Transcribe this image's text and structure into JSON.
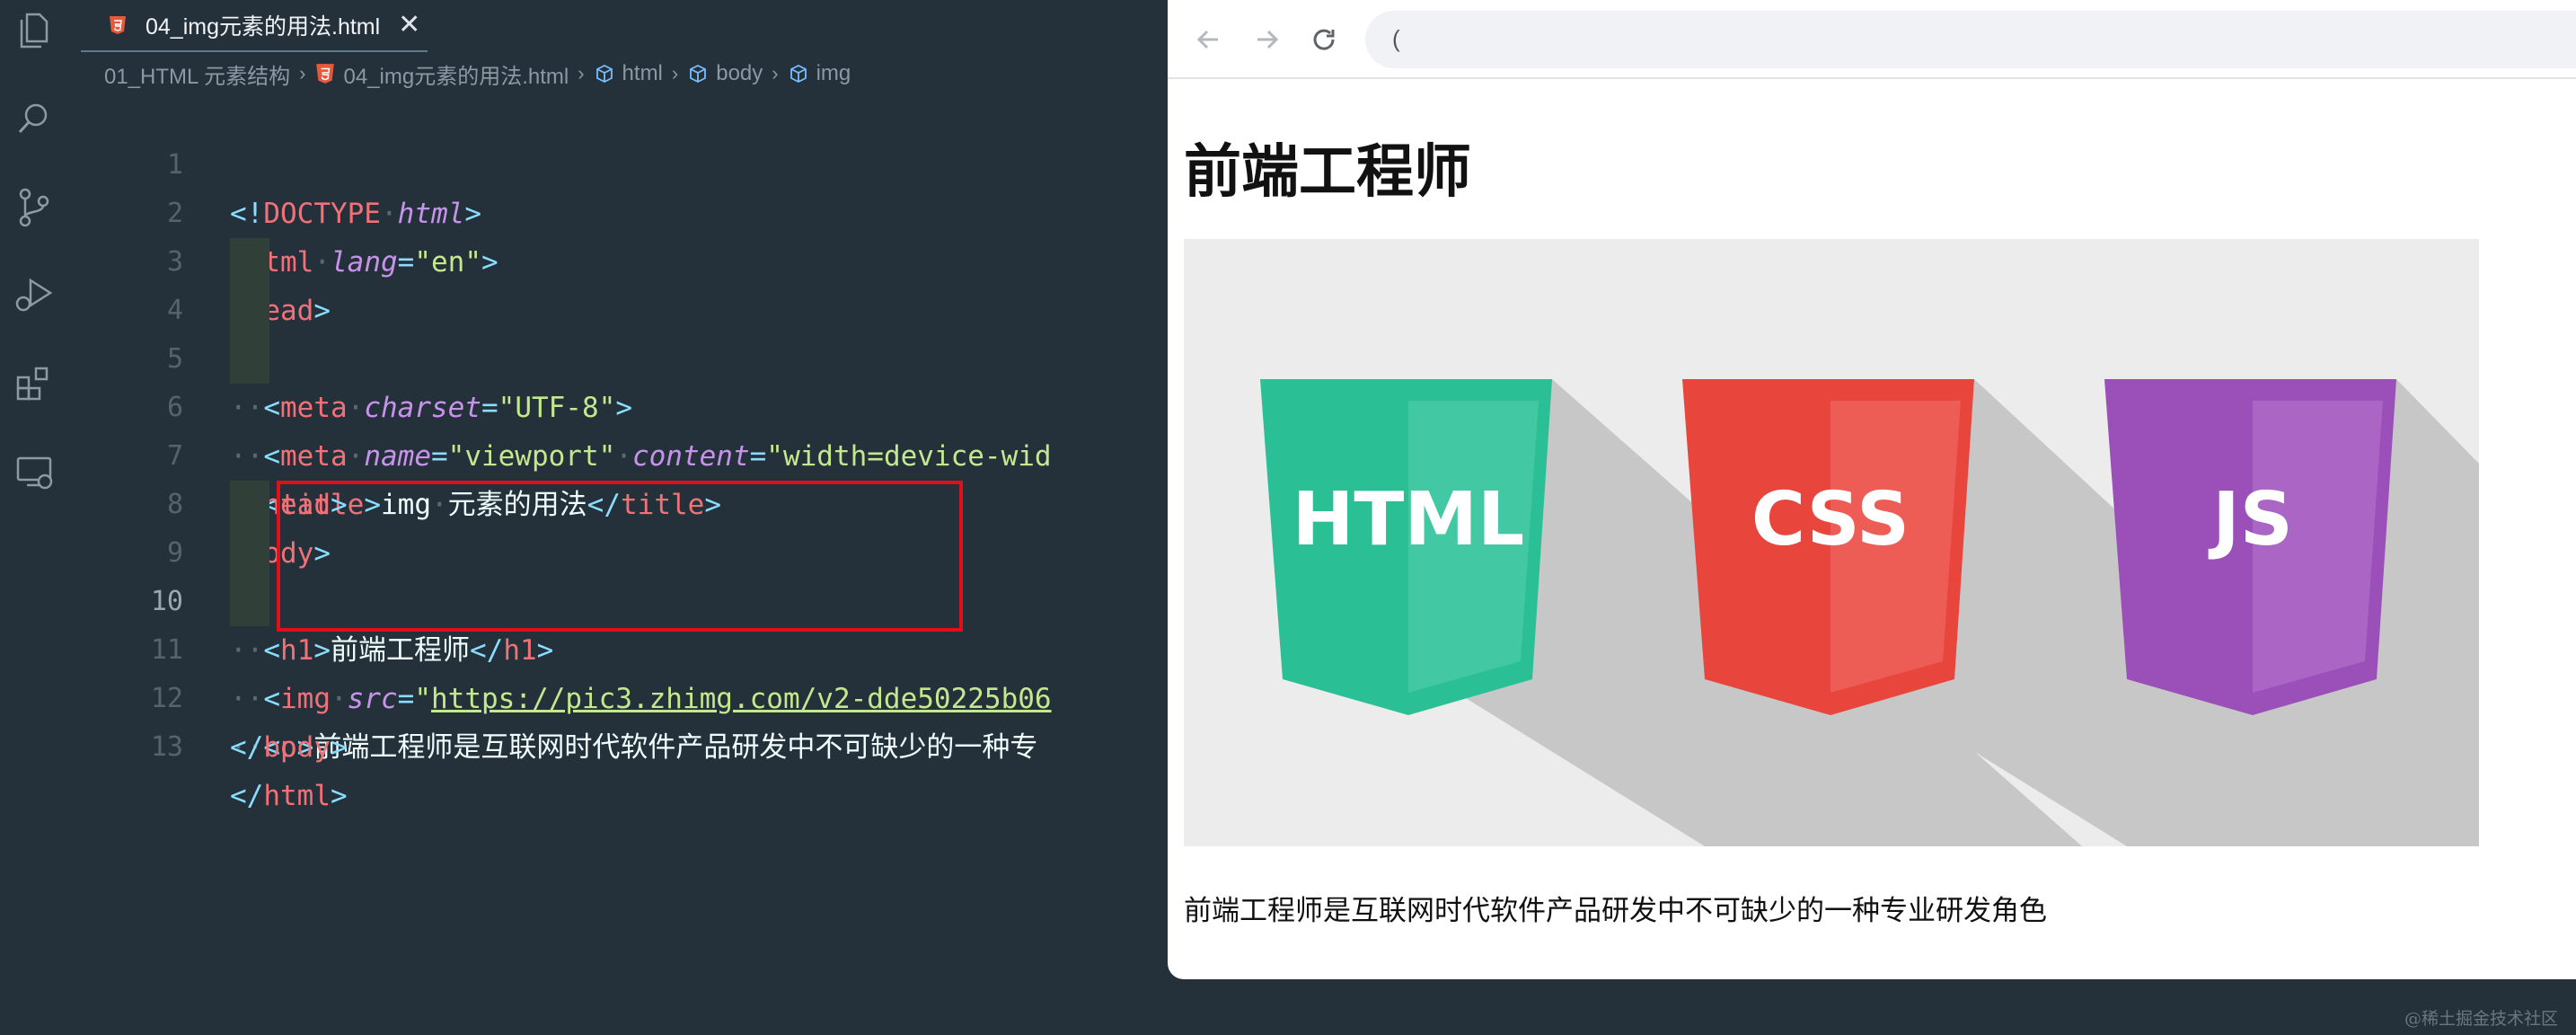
{
  "editor": {
    "tab": {
      "label": "04_img元素的用法.html",
      "close": "✕",
      "file_icon": "html5-file-icon"
    },
    "breadcrumb": [
      "01_HTML 元素结构",
      "04_img元素的用法.html",
      "html",
      "body",
      "img"
    ],
    "line_numbers": [
      "1",
      "2",
      "3",
      "4",
      "5",
      "6",
      "7",
      "8",
      "9",
      "10",
      "11",
      "12",
      "13"
    ],
    "active_line": "10"
  },
  "code": {
    "l1": {
      "a": "<!",
      "b": "DOCTYPE",
      "c": "html",
      "d": ">"
    },
    "l2": {
      "a": "<",
      "b": "html",
      "c": "lang",
      "d": "=",
      "e": "\"en\"",
      "f": ">"
    },
    "l3": {
      "a": "<",
      "b": "head",
      "c": ">"
    },
    "l4": {
      "a": "<",
      "b": "meta",
      "c": "charset",
      "d": "=",
      "e": "\"UTF-8\"",
      "f": ">"
    },
    "l5": {
      "a": "<",
      "b": "meta",
      "c": "name",
      "d": "=",
      "e": "\"viewport\"",
      "f": "content",
      "g": "=",
      "h": "\"width=device-wid"
    },
    "l6": {
      "a": "<",
      "b": "title",
      "c": ">",
      "d": "img",
      "e": "元素的用法",
      "f": "</",
      "g": "title",
      "h": ">"
    },
    "l7": {
      "a": "</",
      "b": "head",
      "c": ">"
    },
    "l8": {
      "a": "<",
      "b": "body",
      "c": ">"
    },
    "l9": {
      "a": "<",
      "b": "h1",
      "c": ">",
      "d": "前端工程师",
      "e": "</",
      "f": "h1",
      "g": ">"
    },
    "l10": {
      "a": "<",
      "b": "img",
      "c": "src",
      "d": "=",
      "e": "\"",
      "f": "https://pic3.zhimg.com/v2-dde50225b06"
    },
    "l11": {
      "a": "<",
      "b": "p",
      "c": ">",
      "d": "前端工程师是互联网时代软件产品研发中不可缺少的一种专"
    },
    "l12": {
      "a": "</",
      "b": "body",
      "c": ">"
    },
    "l13": {
      "a": "</",
      "b": "html",
      "c": ">"
    }
  },
  "browser": {
    "address_prefix": "(",
    "page": {
      "heading": "前端工程师",
      "image_labels": [
        "HTML",
        "CSS",
        "JS"
      ],
      "paragraph": "前端工程师是互联网时代软件产品研发中不可缺少的一种专业研发角色"
    }
  },
  "watermark": "@稀土掘金技术社区",
  "colors": {
    "editor_bg": "#25313a",
    "html_shield": "#2bbf96",
    "css_shield": "#e8453c",
    "js_shield": "#9b4fb8",
    "selection_box": "#e0101a"
  }
}
